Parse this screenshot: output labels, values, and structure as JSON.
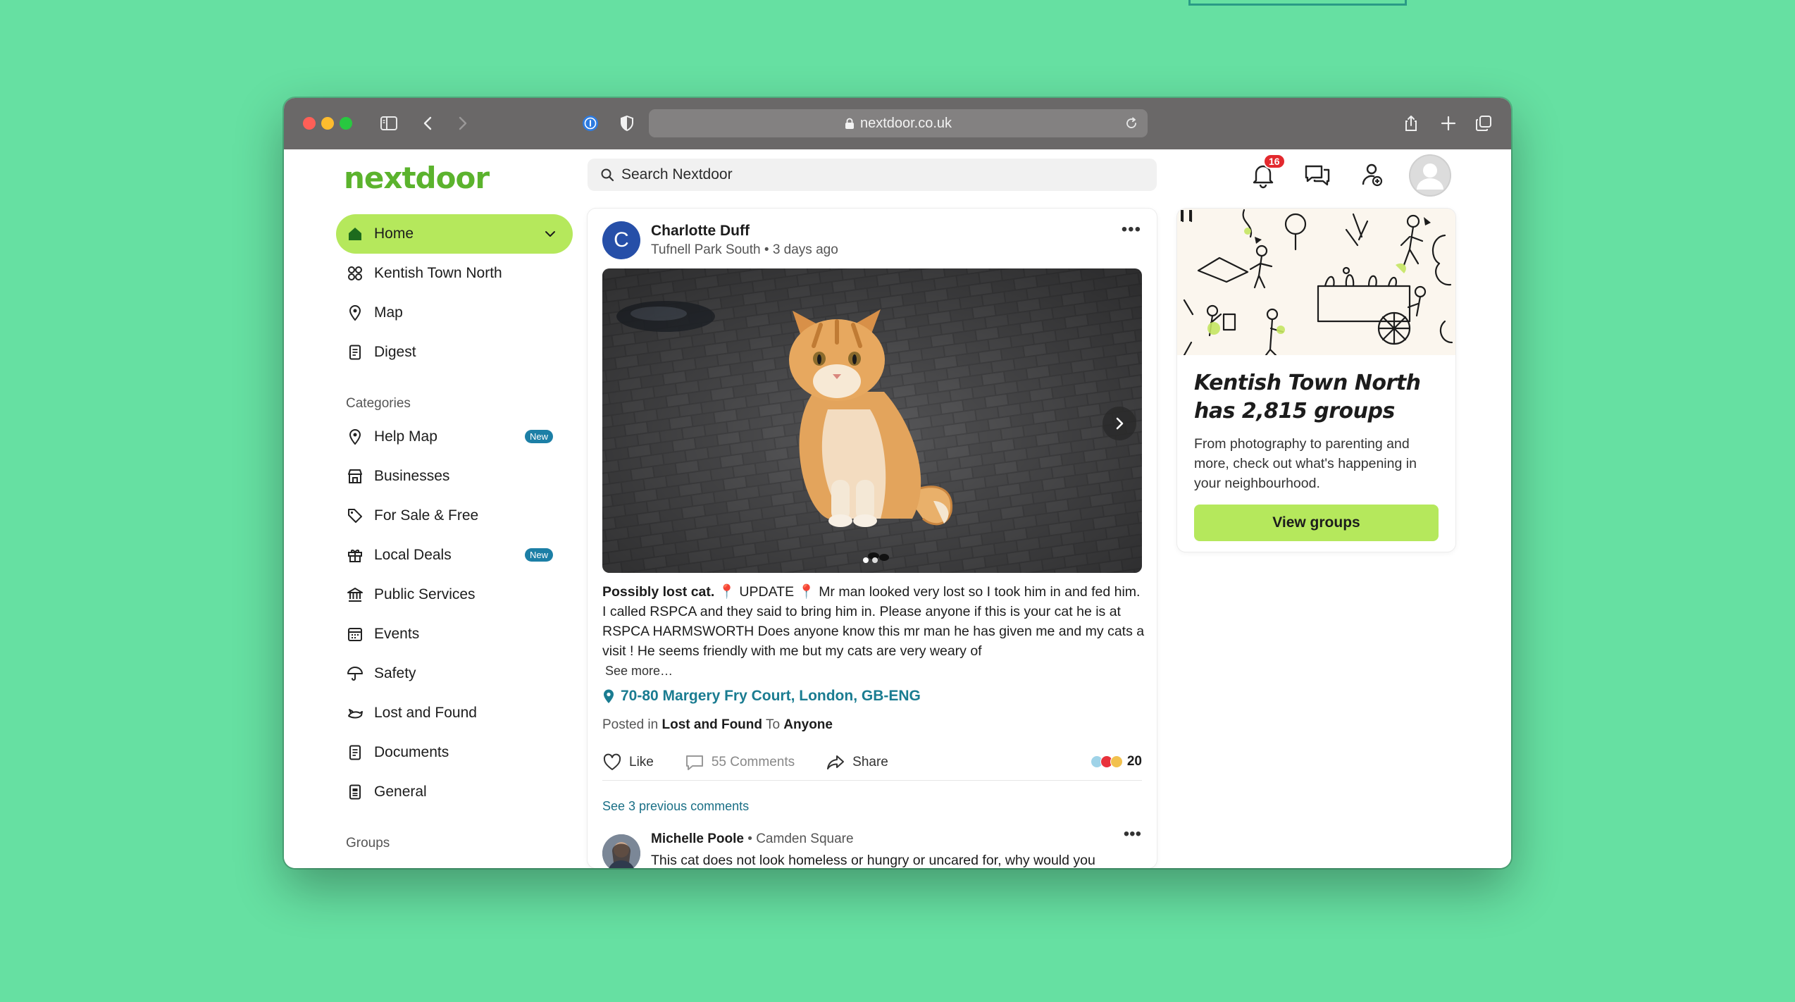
{
  "browser": {
    "url": "nextdoor.co.uk"
  },
  "header": {
    "logo_text": "nextdoor",
    "search_placeholder": "Search Nextdoor",
    "notification_count": "16"
  },
  "sidebar": {
    "main_items": [
      {
        "label": "Home",
        "icon": "house-icon"
      },
      {
        "label": "Kentish Town North",
        "icon": "neighborhood-icon"
      },
      {
        "label": "Map",
        "icon": "map-pin-icon"
      },
      {
        "label": "Digest",
        "icon": "document-icon"
      }
    ],
    "categories_label": "Categories",
    "category_items": [
      {
        "label": "Help Map",
        "badge": "New"
      },
      {
        "label": "Businesses",
        "badge": ""
      },
      {
        "label": "For Sale & Free",
        "badge": ""
      },
      {
        "label": "Local Deals",
        "badge": "New"
      },
      {
        "label": "Public Services",
        "badge": ""
      },
      {
        "label": "Events",
        "badge": ""
      },
      {
        "label": "Safety",
        "badge": ""
      },
      {
        "label": "Lost and Found",
        "badge": ""
      },
      {
        "label": "Documents",
        "badge": ""
      },
      {
        "label": "General",
        "badge": ""
      }
    ],
    "groups_label": "Groups"
  },
  "post": {
    "avatar_letter": "C",
    "author": "Charlotte Duff",
    "neighborhood": "Tufnell Park South",
    "time": "3 days ago",
    "title": "Possibly lost cat.",
    "body": " 📍 UPDATE 📍  Mr man looked very lost so I took him in and fed him. I called RSPCA and they said to bring him in. Please anyone if this is your cat he is at RSPCA HARMSWORTH Does anyone know this mr man he has given me and my cats a visit ! He seems friendly with me but my cats are very weary of",
    "see_more": "See more…",
    "location": "70-80 Margery Fry Court, London, GB-ENG",
    "posted_in_prefix": "Posted in",
    "category": "Lost and Found",
    "to_prefix": "To",
    "audience": "Anyone",
    "like_label": "Like",
    "comments_label": "55 Comments",
    "share_label": "Share",
    "reaction_count": "20",
    "see_previous": "See 3 previous comments",
    "comment": {
      "author": "Michelle Poole",
      "neighborhood": "Camden Square",
      "text": "This cat does not look homeless or hungry or uncared for, why would you"
    }
  },
  "promo": {
    "title": "Kentish Town North has 2,815 groups",
    "text": "From photography to parenting and more, check out what's happening in your neighbourhood.",
    "button": "View groups"
  },
  "colors": {
    "brand_green": "#5bb32d",
    "active_lime": "#b5e85c",
    "link_teal": "#1a7c91",
    "badge_blue": "#1c7fa6",
    "notification_red": "#e3292e",
    "desktop_background": "#66e0a2"
  }
}
